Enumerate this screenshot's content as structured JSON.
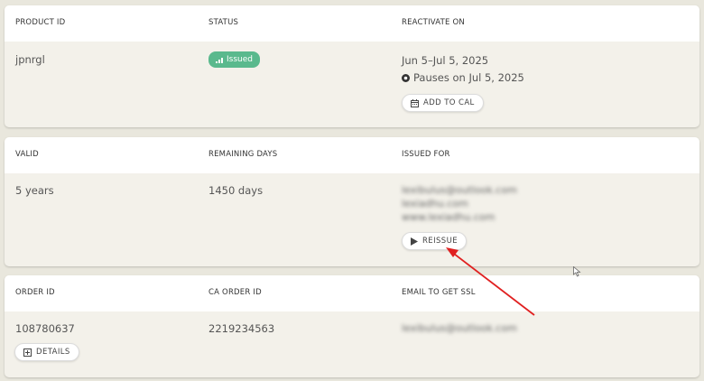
{
  "card1": {
    "headers": [
      "PRODUCT ID",
      "STATUS",
      "REACTIVATE ON"
    ],
    "product_id": "jpnrgl",
    "status": "Issued",
    "reactivate_range": "Jun 5–Jul 5, 2025",
    "pauses": "Pauses on Jul 5, 2025",
    "add_to_cal": "ADD TO CAL"
  },
  "card2": {
    "headers": [
      "VALID",
      "REMAINING DAYS",
      "ISSUED FOR"
    ],
    "valid": "5 years",
    "remaining": "1450 days",
    "issued_for": [
      "lexibulus@outlook.com",
      "lexiadhu.com",
      "www.lexiadhu.com"
    ],
    "reissue": "REISSUE"
  },
  "card3": {
    "headers": [
      "ORDER ID",
      "CA ORDER ID",
      "EMAIL TO GET SSL"
    ],
    "order_id": "108780637",
    "ca_order_id": "2219234563",
    "email": "lexibulus@outlook.com",
    "details": "DETAILS"
  },
  "colors": {
    "issued_badge": "#5ab98d",
    "annotation_arrow": "#e02020"
  }
}
